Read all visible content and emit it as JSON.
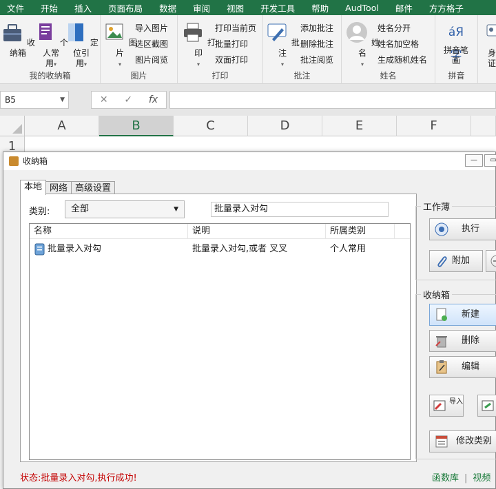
{
  "ribbon_tabs": [
    "文件",
    "开始",
    "插入",
    "页面布局",
    "数据",
    "审阅",
    "视图",
    "开发工具",
    "帮助",
    "AudTool",
    "邮件",
    "方方格子"
  ],
  "ribbon": {
    "group_storage": {
      "label": "我的收纳箱",
      "btn_storage": "收\n纳箱",
      "btn_personal": "个人常\n用",
      "btn_locate": "定位引\n用"
    },
    "group_picture": {
      "label": "图片",
      "btn_picture": "图片",
      "import": "导入图片",
      "select_screenshot": "选区截图",
      "browse": "图片阅览"
    },
    "group_print": {
      "label": "打印",
      "btn_print": "打印",
      "print_current": "打印当前页",
      "batch_print": "批量打印",
      "duplex_print": "双面打印"
    },
    "group_comment": {
      "label": "批注",
      "btn_comment": "批注",
      "add": "添加批注",
      "delete": "删除批注",
      "browse": "批注阅览"
    },
    "group_name": {
      "label": "姓名",
      "btn_name": "姓名",
      "split": "姓名分开",
      "add_space": "姓名加空格",
      "random": "生成随机姓名"
    },
    "group_pinyin": {
      "label": "拼音",
      "btn_pinyin": "拼音笔\n画",
      "ico_text": "áЯ字"
    },
    "group_id": {
      "btn_id": "身\n证"
    }
  },
  "formula_bar": {
    "name_box": "B5",
    "cancel": "✕",
    "enter": "✓",
    "fx": "fx",
    "formula": ""
  },
  "grid": {
    "columns": [
      "A",
      "B",
      "C",
      "D",
      "E",
      "F"
    ],
    "selected_column": "B",
    "rows": [
      "1"
    ]
  },
  "dialog": {
    "title": "收纳箱",
    "tabs": [
      "本地",
      "网络",
      "高级设置"
    ],
    "active_tab": "本地",
    "category_label": "类别:",
    "category_value": "全部",
    "search_value": "批量录入对勾",
    "list": {
      "headers": [
        "名称",
        "说明",
        "所属类别"
      ],
      "rows": [
        {
          "name": "批量录入对勾",
          "desc": "批量录入对勾,或者 叉叉",
          "category": "个人常用"
        }
      ]
    },
    "workbook_group": {
      "legend": "工作薄",
      "execute": "执行",
      "attach": "附加"
    },
    "storage_group": {
      "legend": "收纳箱",
      "new": "新建",
      "delete": "删除",
      "edit": "编辑",
      "import": "导入",
      "modify_category": "修改类别"
    },
    "status": "状态:批量录入对勾,执行成功!",
    "footer_links": [
      "函数库",
      "视频"
    ]
  }
}
